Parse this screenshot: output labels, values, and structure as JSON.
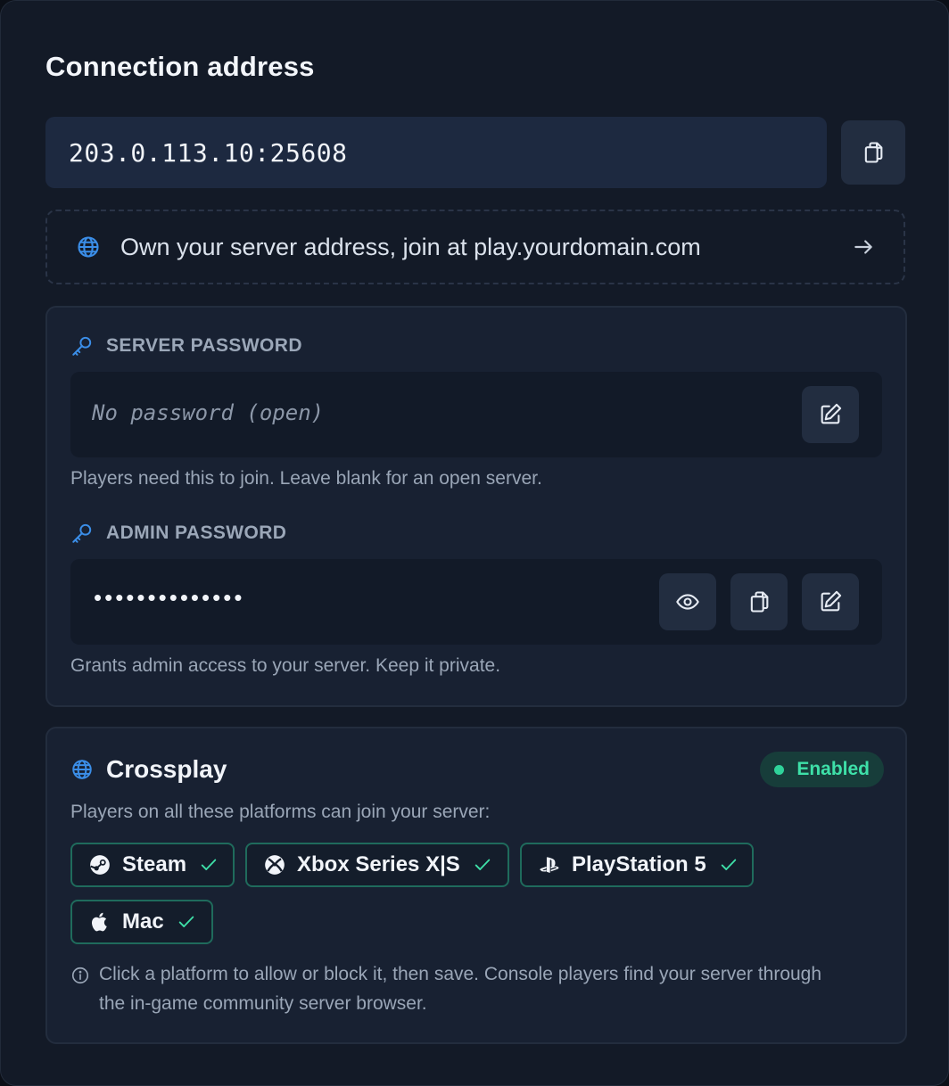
{
  "header": {
    "title": "Connection address"
  },
  "connection": {
    "address": "203.0.113.10:25608"
  },
  "domain_promo": {
    "text": "Own your server address, join at play.yourdomain.com"
  },
  "server_password": {
    "label": "SERVER PASSWORD",
    "placeholder": "No password (open)",
    "hint": "Players need this to join. Leave blank for an open server."
  },
  "admin_password": {
    "label": "ADMIN PASSWORD",
    "masked_value": "••••••••••••••",
    "hint": "Grants admin access to your server. Keep it private."
  },
  "crossplay": {
    "title": "Crossplay",
    "status": "Enabled",
    "subtitle": "Players on all these platforms can join your server:",
    "platforms": [
      {
        "label": "Steam",
        "icon": "steam-icon"
      },
      {
        "label": "Xbox Series X|S",
        "icon": "xbox-icon"
      },
      {
        "label": "PlayStation 5",
        "icon": "playstation-icon"
      },
      {
        "label": "Mac",
        "icon": "apple-icon"
      }
    ],
    "info": "Click a platform to allow or block it, then save. Console players find your server through the in-game community server browser."
  },
  "colors": {
    "accent_blue": "#3b8ee8",
    "success_green": "#3ee0a8",
    "chip_border": "#1f6b5c"
  }
}
